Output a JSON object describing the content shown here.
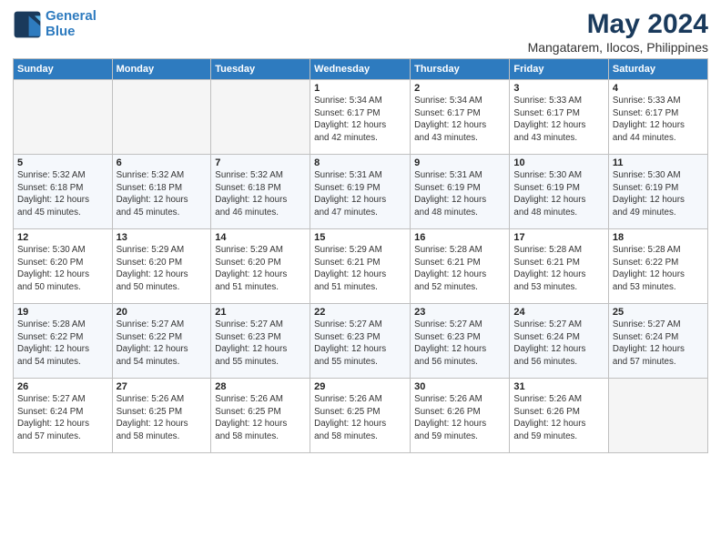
{
  "logo": {
    "line1": "General",
    "line2": "Blue"
  },
  "title": "May 2024",
  "subtitle": "Mangatarem, Ilocos, Philippines",
  "days_of_week": [
    "Sunday",
    "Monday",
    "Tuesday",
    "Wednesday",
    "Thursday",
    "Friday",
    "Saturday"
  ],
  "weeks": [
    [
      {
        "day": "",
        "info": ""
      },
      {
        "day": "",
        "info": ""
      },
      {
        "day": "",
        "info": ""
      },
      {
        "day": "1",
        "info": "Sunrise: 5:34 AM\nSunset: 6:17 PM\nDaylight: 12 hours\nand 42 minutes."
      },
      {
        "day": "2",
        "info": "Sunrise: 5:34 AM\nSunset: 6:17 PM\nDaylight: 12 hours\nand 43 minutes."
      },
      {
        "day": "3",
        "info": "Sunrise: 5:33 AM\nSunset: 6:17 PM\nDaylight: 12 hours\nand 43 minutes."
      },
      {
        "day": "4",
        "info": "Sunrise: 5:33 AM\nSunset: 6:17 PM\nDaylight: 12 hours\nand 44 minutes."
      }
    ],
    [
      {
        "day": "5",
        "info": "Sunrise: 5:32 AM\nSunset: 6:18 PM\nDaylight: 12 hours\nand 45 minutes."
      },
      {
        "day": "6",
        "info": "Sunrise: 5:32 AM\nSunset: 6:18 PM\nDaylight: 12 hours\nand 45 minutes."
      },
      {
        "day": "7",
        "info": "Sunrise: 5:32 AM\nSunset: 6:18 PM\nDaylight: 12 hours\nand 46 minutes."
      },
      {
        "day": "8",
        "info": "Sunrise: 5:31 AM\nSunset: 6:19 PM\nDaylight: 12 hours\nand 47 minutes."
      },
      {
        "day": "9",
        "info": "Sunrise: 5:31 AM\nSunset: 6:19 PM\nDaylight: 12 hours\nand 48 minutes."
      },
      {
        "day": "10",
        "info": "Sunrise: 5:30 AM\nSunset: 6:19 PM\nDaylight: 12 hours\nand 48 minutes."
      },
      {
        "day": "11",
        "info": "Sunrise: 5:30 AM\nSunset: 6:19 PM\nDaylight: 12 hours\nand 49 minutes."
      }
    ],
    [
      {
        "day": "12",
        "info": "Sunrise: 5:30 AM\nSunset: 6:20 PM\nDaylight: 12 hours\nand 50 minutes."
      },
      {
        "day": "13",
        "info": "Sunrise: 5:29 AM\nSunset: 6:20 PM\nDaylight: 12 hours\nand 50 minutes."
      },
      {
        "day": "14",
        "info": "Sunrise: 5:29 AM\nSunset: 6:20 PM\nDaylight: 12 hours\nand 51 minutes."
      },
      {
        "day": "15",
        "info": "Sunrise: 5:29 AM\nSunset: 6:21 PM\nDaylight: 12 hours\nand 51 minutes."
      },
      {
        "day": "16",
        "info": "Sunrise: 5:28 AM\nSunset: 6:21 PM\nDaylight: 12 hours\nand 52 minutes."
      },
      {
        "day": "17",
        "info": "Sunrise: 5:28 AM\nSunset: 6:21 PM\nDaylight: 12 hours\nand 53 minutes."
      },
      {
        "day": "18",
        "info": "Sunrise: 5:28 AM\nSunset: 6:22 PM\nDaylight: 12 hours\nand 53 minutes."
      }
    ],
    [
      {
        "day": "19",
        "info": "Sunrise: 5:28 AM\nSunset: 6:22 PM\nDaylight: 12 hours\nand 54 minutes."
      },
      {
        "day": "20",
        "info": "Sunrise: 5:27 AM\nSunset: 6:22 PM\nDaylight: 12 hours\nand 54 minutes."
      },
      {
        "day": "21",
        "info": "Sunrise: 5:27 AM\nSunset: 6:23 PM\nDaylight: 12 hours\nand 55 minutes."
      },
      {
        "day": "22",
        "info": "Sunrise: 5:27 AM\nSunset: 6:23 PM\nDaylight: 12 hours\nand 55 minutes."
      },
      {
        "day": "23",
        "info": "Sunrise: 5:27 AM\nSunset: 6:23 PM\nDaylight: 12 hours\nand 56 minutes."
      },
      {
        "day": "24",
        "info": "Sunrise: 5:27 AM\nSunset: 6:24 PM\nDaylight: 12 hours\nand 56 minutes."
      },
      {
        "day": "25",
        "info": "Sunrise: 5:27 AM\nSunset: 6:24 PM\nDaylight: 12 hours\nand 57 minutes."
      }
    ],
    [
      {
        "day": "26",
        "info": "Sunrise: 5:27 AM\nSunset: 6:24 PM\nDaylight: 12 hours\nand 57 minutes."
      },
      {
        "day": "27",
        "info": "Sunrise: 5:26 AM\nSunset: 6:25 PM\nDaylight: 12 hours\nand 58 minutes."
      },
      {
        "day": "28",
        "info": "Sunrise: 5:26 AM\nSunset: 6:25 PM\nDaylight: 12 hours\nand 58 minutes."
      },
      {
        "day": "29",
        "info": "Sunrise: 5:26 AM\nSunset: 6:25 PM\nDaylight: 12 hours\nand 58 minutes."
      },
      {
        "day": "30",
        "info": "Sunrise: 5:26 AM\nSunset: 6:26 PM\nDaylight: 12 hours\nand 59 minutes."
      },
      {
        "day": "31",
        "info": "Sunrise: 5:26 AM\nSunset: 6:26 PM\nDaylight: 12 hours\nand 59 minutes."
      },
      {
        "day": "",
        "info": ""
      }
    ]
  ]
}
